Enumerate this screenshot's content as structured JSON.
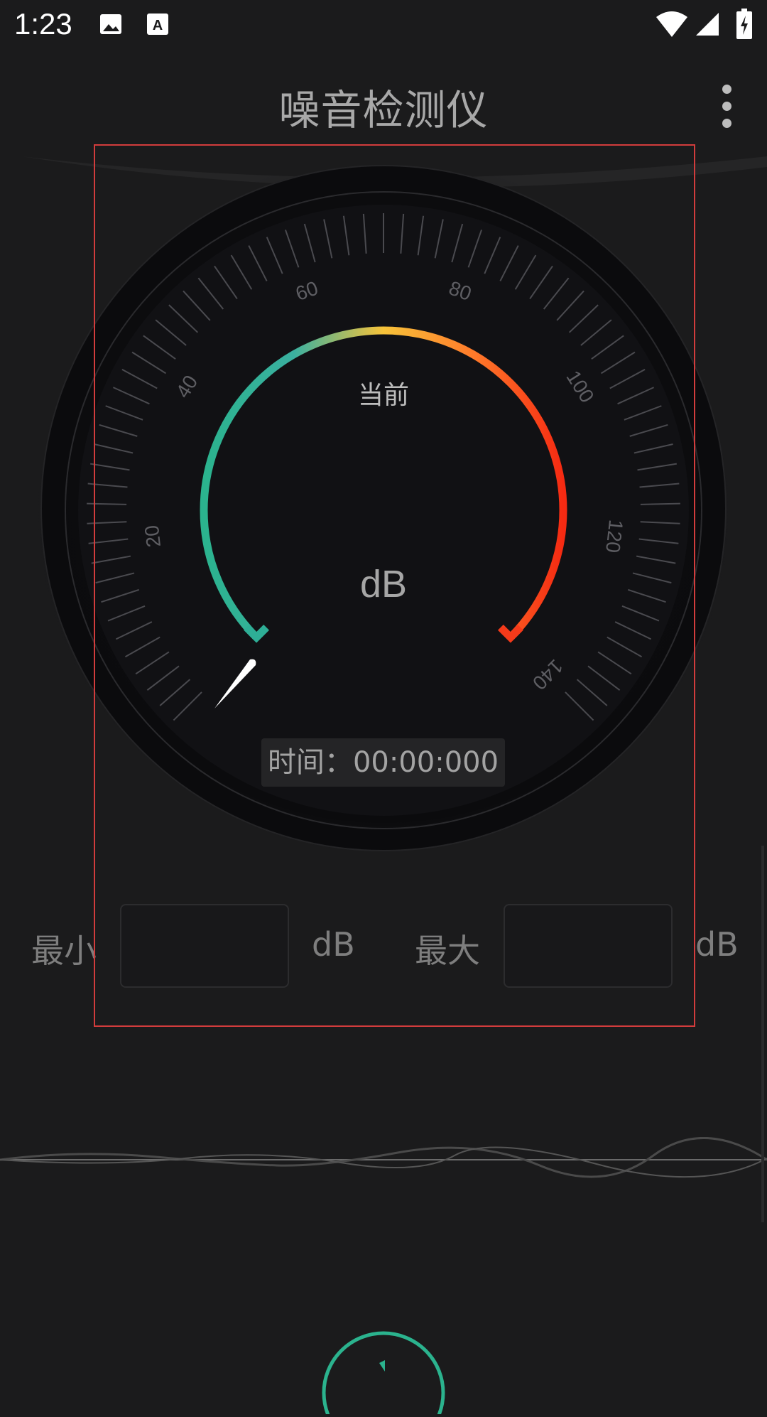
{
  "status_bar": {
    "time": "1:23",
    "icons": [
      "image-icon",
      "font-download-icon",
      "wifi-icon",
      "signal-icon",
      "battery-charging-icon"
    ]
  },
  "app_bar": {
    "title": "噪音检测仪",
    "menu_icon": "more-vert-icon"
  },
  "gauge": {
    "current_label": "当前",
    "unit": "dB",
    "scale_labels": [
      "20",
      "40",
      "60",
      "80",
      "100",
      "120",
      "140"
    ],
    "colors": {
      "arc_start": "#2bb38e",
      "arc_mid": "#f7c33a",
      "arc_end": "#f52a12",
      "needle": "#ffffff"
    }
  },
  "timer": {
    "label": "时间：",
    "value": "00:00:000"
  },
  "range": {
    "min_label": "最小",
    "min_value": "",
    "min_unit": "dB",
    "max_label": "最大",
    "max_value": "",
    "max_unit": "dB"
  },
  "controls": {
    "start_button_icon": "play-icon",
    "accent": "#2bb38e"
  }
}
